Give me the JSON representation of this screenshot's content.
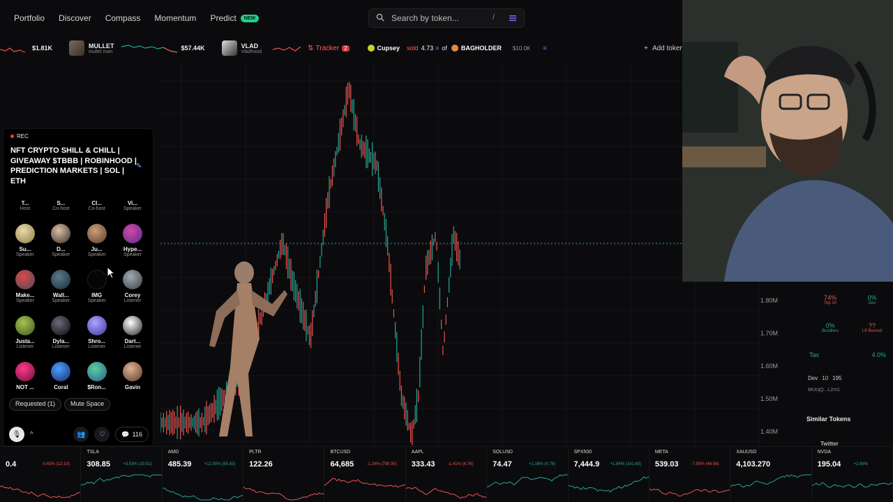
{
  "nav": {
    "items": [
      "Portfolio",
      "Discover",
      "Compass",
      "Momentum",
      "Predict"
    ],
    "predict_badge": "NEW",
    "search_placeholder": "Search by token...",
    "search_shortcut": "/"
  },
  "ticker": {
    "left_value": "$1.81K",
    "items": [
      {
        "name": "MULLET",
        "sub": "mullet man",
        "value": "$57.44K"
      },
      {
        "name": "VLAD",
        "sub": "Vladhood",
        "value": ""
      }
    ],
    "tracker_label": "Tracker",
    "tracker_count": "2",
    "trade": {
      "user": "Cupsey",
      "action": "sold",
      "amount": "4.73",
      "of": "of",
      "token": "BAGHOLDER",
      "mc": "$10.0K"
    },
    "add_token": "Add token"
  },
  "space": {
    "rec": "REC",
    "title": "NFT CRYPTO SHILL & CHILL | GIVEAWAY $TBBB | ROBINHOOD | PREDICTION MARKETS | SOL | ETH",
    "rows": [
      [
        {
          "n": "T...",
          "r": "Host"
        },
        {
          "n": "S...",
          "r": "Co-host"
        },
        {
          "n": "Cl...",
          "r": "Co-host"
        },
        {
          "n": "Vi...",
          "r": "Speaker"
        }
      ],
      [
        {
          "n": "Su...",
          "r": "Speaker"
        },
        {
          "n": "D...",
          "r": "Speaker"
        },
        {
          "n": "Ju...",
          "r": "Speaker"
        },
        {
          "n": "Hype...",
          "r": "Speaker"
        }
      ],
      [
        {
          "n": "Make...",
          "r": "Speaker"
        },
        {
          "n": "Wall...",
          "r": "Speaker"
        },
        {
          "n": "IMG",
          "r": "Speaker"
        },
        {
          "n": "Corey",
          "r": "Listener"
        }
      ],
      [
        {
          "n": "Justa...",
          "r": "Listener"
        },
        {
          "n": "Dyla...",
          "r": "Listener"
        },
        {
          "n": "Shro...",
          "r": "Listener"
        },
        {
          "n": "Dart...",
          "r": "Listener"
        }
      ],
      [
        {
          "n": "NOT ...",
          "r": ""
        },
        {
          "n": "Coral",
          "r": ""
        },
        {
          "n": "$Ron...",
          "r": ""
        },
        {
          "n": "Gavin",
          "r": ""
        }
      ]
    ],
    "requested": "Requested (1)",
    "mute": "Mute Space",
    "comments": "116"
  },
  "price_axis": [
    "1.80M",
    "1.70M",
    "1.60M",
    "1.50M",
    "1.40M"
  ],
  "stats": {
    "top10": "74%",
    "top10_label": "Top 10",
    "dev": "0%",
    "dev_label": "Dev",
    "bundlers": "0%",
    "bundlers_label": "Bundlers",
    "lp": "??",
    "lp_label": "LP Burned",
    "tax_label": "Tax",
    "tax": "4.0%",
    "dev_row": "Dev",
    "dev_row_n1": "10",
    "dev_row_n2": "195",
    "ca": "8KXqQ...L2m1",
    "similar": "Similar Tokens",
    "twitter": "Twitter"
  },
  "bottom": [
    {
      "sym": "",
      "price": "0.4",
      "chg": "-0.63% (12.10)",
      "up": false
    },
    {
      "sym": "TSLA",
      "price": "308.85",
      "chg": "+3.53% (10.51)",
      "up": true
    },
    {
      "sym": "AMD",
      "price": "485.39",
      "chg": "+12.00% (55.83)",
      "up": true
    },
    {
      "sym": "PLTR",
      "price": "122.26",
      "chg": "",
      "up": false
    },
    {
      "sym": "BTCUSD",
      "price": "64,685",
      "chg": "-1.24% (790.00)",
      "up": false
    },
    {
      "sym": "AAPL",
      "price": "333.43",
      "chg": "-1.41% (4.76)",
      "up": false
    },
    {
      "sym": "SOLUSD",
      "price": "74.47",
      "chg": "+1.08% (0.79)",
      "up": true
    },
    {
      "sym": "SPX500",
      "price": "7,444.9",
      "chg": "+1.94% (141.60)",
      "up": true
    },
    {
      "sym": "META",
      "price": "539.03",
      "chg": "-7.95% (46.58)",
      "up": false
    },
    {
      "sym": "XAUUSD",
      "price": "4,103.270",
      "chg": "",
      "up": true
    },
    {
      "sym": "NVDA",
      "price": "195.04",
      "chg": "+2.68%",
      "up": true
    }
  ],
  "colors": {
    "up": "#26a69a",
    "down": "#ef5350",
    "accent": "#1fd18a"
  }
}
